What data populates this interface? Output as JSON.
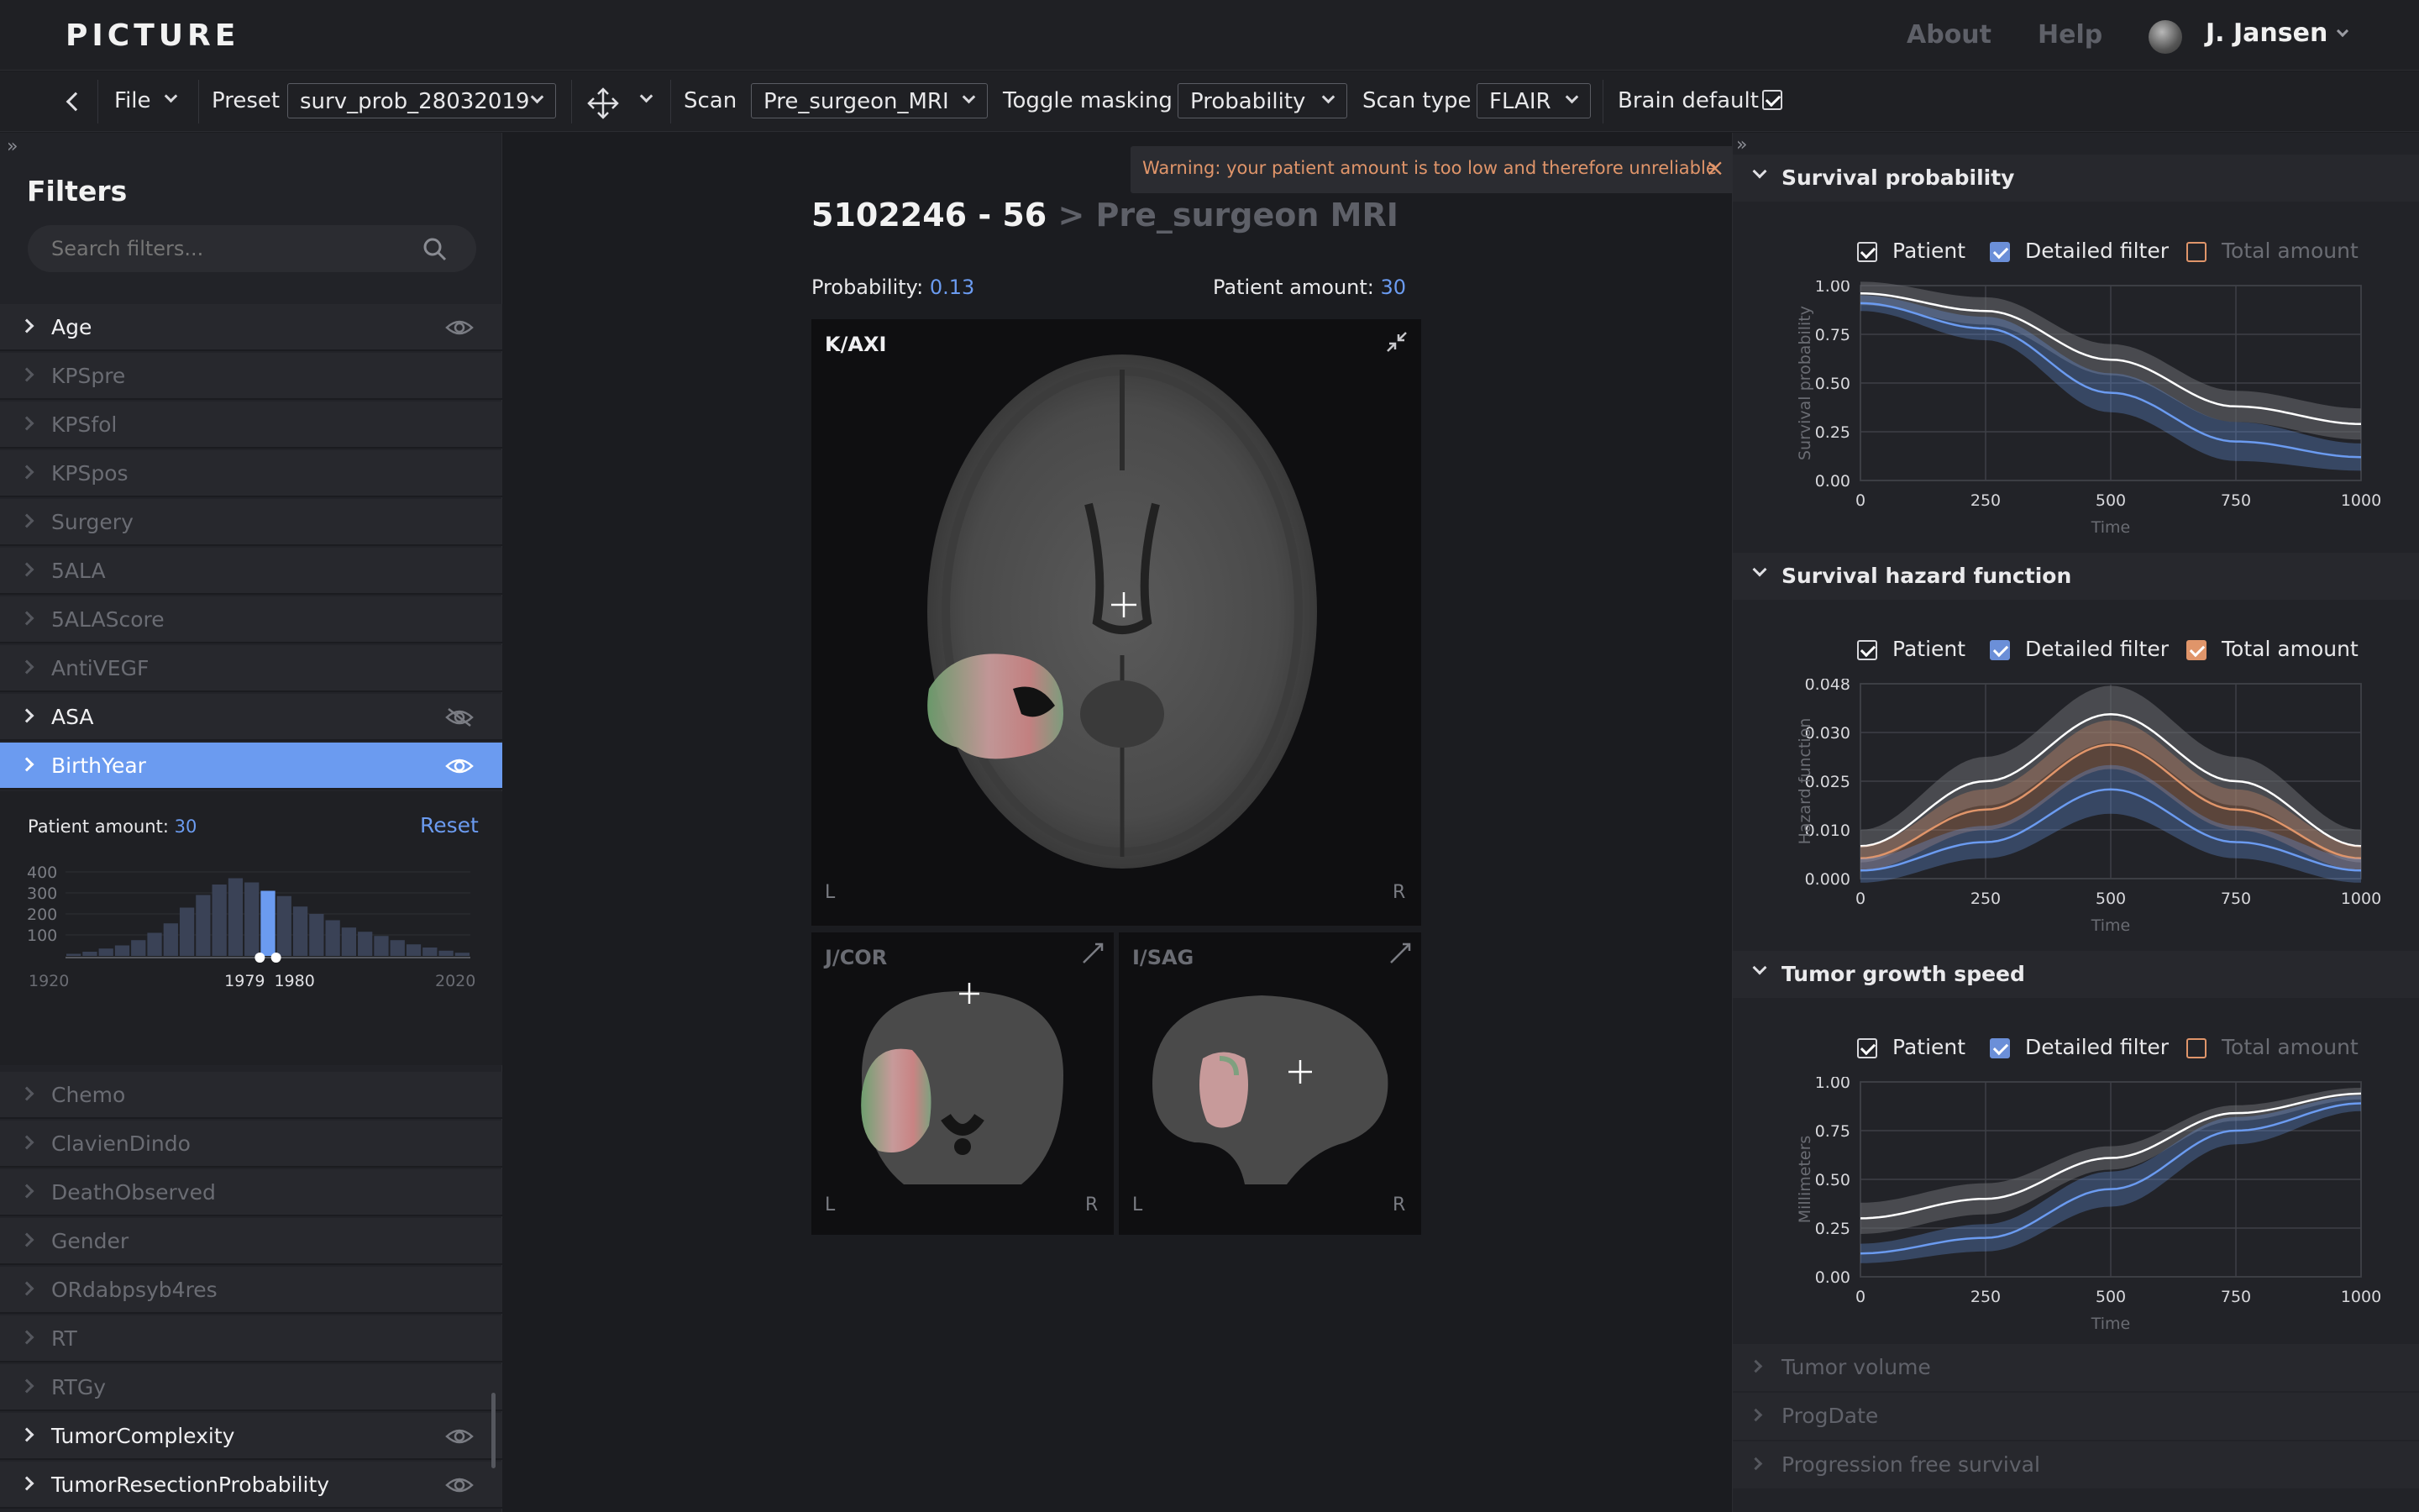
{
  "app": {
    "logo": "PICTURE"
  },
  "nav": {
    "about": "About",
    "help": "Help",
    "user": "J. Jansen"
  },
  "toolbar": {
    "file": "File",
    "preset_label": "Preset",
    "preset_value": "surv_prob_28032019",
    "scan_label": "Scan",
    "scan_value": "Pre_surgeon_MRI",
    "masking_label": "Toggle masking",
    "masking_value": "Probability",
    "scantype_label": "Scan type",
    "scantype_value": "FLAIR",
    "brain_label": "Brain default"
  },
  "sidebar": {
    "title": "Filters",
    "search_placeholder": "Search filters...",
    "items_top": [
      {
        "label": "Age",
        "state": "bright",
        "eye": "visible"
      },
      {
        "label": "KPSpre",
        "state": "dim"
      },
      {
        "label": "KPSfol",
        "state": "dim"
      },
      {
        "label": "KPSpos",
        "state": "dim"
      },
      {
        "label": "Surgery",
        "state": "dim"
      },
      {
        "label": "5ALA",
        "state": "dim"
      },
      {
        "label": "5ALAScore",
        "state": "dim"
      },
      {
        "label": "AntiVEGF",
        "state": "dim"
      },
      {
        "label": "ASA",
        "state": "bright",
        "eye": "hidden"
      },
      {
        "label": "BirthYear",
        "state": "selected",
        "eye": "visible"
      }
    ],
    "birthyear": {
      "patient_amount_label": "Patient amount:",
      "patient_amount": "30",
      "reset": "Reset",
      "yticks": [
        "400",
        "300",
        "200",
        "100"
      ],
      "x_min": "1920",
      "x_max": "2020",
      "sel_start": "1979",
      "sel_end": "1980",
      "histogram": [
        10,
        20,
        35,
        50,
        75,
        110,
        155,
        230,
        290,
        340,
        370,
        350,
        310,
        285,
        235,
        200,
        170,
        135,
        115,
        95,
        75,
        55,
        40,
        25,
        15
      ],
      "selected_bin": 12
    },
    "items_bottom": [
      {
        "label": "Chemo",
        "state": "dim"
      },
      {
        "label": "ClavienDindo",
        "state": "dim"
      },
      {
        "label": "DeathObserved",
        "state": "dim"
      },
      {
        "label": "Gender",
        "state": "dim"
      },
      {
        "label": "ORdabpsyb4res",
        "state": "dim"
      },
      {
        "label": "RT",
        "state": "dim"
      },
      {
        "label": "RTGy",
        "state": "dim"
      },
      {
        "label": "TumorComplexity",
        "state": "bright",
        "eye": "visible"
      },
      {
        "label": "TumorResectionProbability",
        "state": "bright",
        "eye": "visible"
      }
    ]
  },
  "main": {
    "warning": "Warning: your patient amount is too low and therefore unreliable",
    "patient_id": "5102246 - 56",
    "scan_crumb": "> Pre_surgeon MRI",
    "probability_label": "Probability:",
    "probability": "0.13",
    "patient_amount_label": "Patient amount:",
    "patient_amount": "30",
    "views": {
      "axial": {
        "label": "K/AXI",
        "left": "L",
        "right": "R"
      },
      "coronal": {
        "label": "J/COR",
        "left": "L",
        "right": "R"
      },
      "sagittal": {
        "label": "I/SAG",
        "left": "L",
        "right": "R"
      }
    }
  },
  "right": {
    "legend": {
      "patient": "Patient",
      "detailed": "Detailed filter",
      "total": "Total amount"
    },
    "sections": [
      {
        "title": "Survival probability",
        "total_on": false
      },
      {
        "title": "Survival hazard function",
        "total_on": true
      },
      {
        "title": "Tumor growth speed",
        "total_on": false
      }
    ],
    "collapsed": [
      "Tumor volume",
      "ProgDate",
      "Progression free survival"
    ]
  },
  "chart_data": [
    {
      "type": "line",
      "xlabel": "Time",
      "ylabel": "Survival probability",
      "xlim": [
        0,
        1000
      ],
      "xticks": [
        0,
        250,
        500,
        750,
        1000
      ],
      "yticks": [
        "0.00",
        "0.25",
        "0.50",
        "0.75",
        "1.00"
      ],
      "ylim": [
        0,
        1
      ],
      "grid": true,
      "series": [
        {
          "name": "Patient",
          "x": [
            0,
            250,
            500,
            750,
            1000
          ],
          "y": [
            0.96,
            0.87,
            0.62,
            0.38,
            0.29
          ],
          "band": [
            0.06,
            0.07,
            0.08,
            0.08,
            0.08
          ],
          "color": "#ffffff"
        },
        {
          "name": "Detailed filter",
          "x": [
            0,
            250,
            500,
            750,
            1000
          ],
          "y": [
            0.91,
            0.78,
            0.45,
            0.2,
            0.12
          ],
          "band": [
            0.04,
            0.06,
            0.1,
            0.1,
            0.07
          ],
          "color": "#6b9bf0"
        }
      ]
    },
    {
      "type": "line",
      "xlabel": "Time",
      "ylabel": "Hazard function",
      "xlim": [
        0,
        1000
      ],
      "xticks": [
        0,
        250,
        500,
        750,
        1000
      ],
      "yticks": [
        "0.000",
        "0.010",
        "0.025",
        "0.030",
        "0.048"
      ],
      "ylim": [
        0,
        0.048
      ],
      "grid": true,
      "series": [
        {
          "name": "Patient",
          "x": [
            0,
            250,
            500,
            750,
            1000
          ],
          "y": [
            0.008,
            0.024,
            0.0405,
            0.024,
            0.008
          ],
          "band": [
            0.004,
            0.006,
            0.007,
            0.006,
            0.004
          ],
          "color": "#ffffff"
        },
        {
          "name": "Total amount",
          "x": [
            0,
            250,
            500,
            750,
            1000
          ],
          "y": [
            0.005,
            0.017,
            0.033,
            0.017,
            0.005
          ],
          "band": [
            0.003,
            0.005,
            0.006,
            0.005,
            0.003
          ],
          "color": "#e0956a"
        },
        {
          "name": "Detailed filter",
          "x": [
            0,
            250,
            500,
            750,
            1000
          ],
          "y": [
            0.002,
            0.009,
            0.022,
            0.009,
            0.002
          ],
          "band": [
            0.003,
            0.004,
            0.006,
            0.004,
            0.003
          ],
          "color": "#6b9bf0"
        }
      ]
    },
    {
      "type": "line",
      "xlabel": "Time",
      "ylabel": "Millimeters",
      "xlim": [
        0,
        1000
      ],
      "xticks": [
        0,
        250,
        500,
        750,
        1000
      ],
      "yticks": [
        "0.00",
        "0.25",
        "0.50",
        "0.75",
        "1.00"
      ],
      "ylim": [
        0,
        1
      ],
      "grid": true,
      "series": [
        {
          "name": "Patient",
          "x": [
            0,
            250,
            500,
            750,
            1000
          ],
          "y": [
            0.3,
            0.4,
            0.61,
            0.84,
            0.94
          ],
          "band": [
            0.08,
            0.08,
            0.06,
            0.04,
            0.03
          ],
          "color": "#ffffff"
        },
        {
          "name": "Detailed filter",
          "x": [
            0,
            250,
            500,
            750,
            1000
          ],
          "y": [
            0.12,
            0.2,
            0.45,
            0.75,
            0.89
          ],
          "band": [
            0.05,
            0.07,
            0.09,
            0.07,
            0.04
          ],
          "color": "#6b9bf0"
        }
      ]
    }
  ]
}
